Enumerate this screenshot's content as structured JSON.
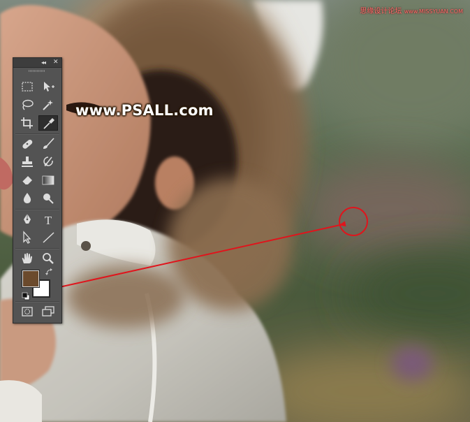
{
  "watermark": {
    "text": "www.PSALL.com"
  },
  "credit": {
    "text": "思缘设计论坛",
    "site": "www.MISSYUAN.COM"
  },
  "colors": {
    "foreground_swatch": "#6b4a2c",
    "background_swatch": "#ffffff",
    "annotation": "#e0141c",
    "panel": "#535353"
  },
  "toolbox": {
    "collapse_label": "◂◂",
    "close_label": "✕",
    "tools": [
      {
        "name": "rectangular-marquee-tool",
        "icon": "marquee-icon"
      },
      {
        "name": "move-tool",
        "icon": "move-icon"
      },
      {
        "name": "lasso-tool",
        "icon": "lasso-icon"
      },
      {
        "name": "magic-wand-tool",
        "icon": "magic-wand-icon"
      },
      {
        "name": "crop-tool",
        "icon": "crop-icon"
      },
      {
        "name": "eyedropper-tool",
        "icon": "eyedropper-icon",
        "active": true
      },
      {
        "name": "healing-brush-tool",
        "icon": "bandage-icon"
      },
      {
        "name": "brush-tool",
        "icon": "brush-icon"
      },
      {
        "name": "clone-stamp-tool",
        "icon": "stamp-icon"
      },
      {
        "name": "history-brush-tool",
        "icon": "history-brush-icon"
      },
      {
        "name": "eraser-tool",
        "icon": "eraser-icon"
      },
      {
        "name": "gradient-tool",
        "icon": "gradient-icon"
      },
      {
        "name": "blur-tool",
        "icon": "drop-icon"
      },
      {
        "name": "dodge-tool",
        "icon": "dodge-icon"
      },
      {
        "name": "pen-tool",
        "icon": "pen-icon"
      },
      {
        "name": "type-tool",
        "icon": "type-icon"
      },
      {
        "name": "path-selection-tool",
        "icon": "arrow-icon"
      },
      {
        "name": "line-tool",
        "icon": "line-icon"
      },
      {
        "name": "hand-tool",
        "icon": "hand-icon"
      },
      {
        "name": "zoom-tool",
        "icon": "zoom-icon"
      }
    ],
    "type_glyph": "T"
  }
}
